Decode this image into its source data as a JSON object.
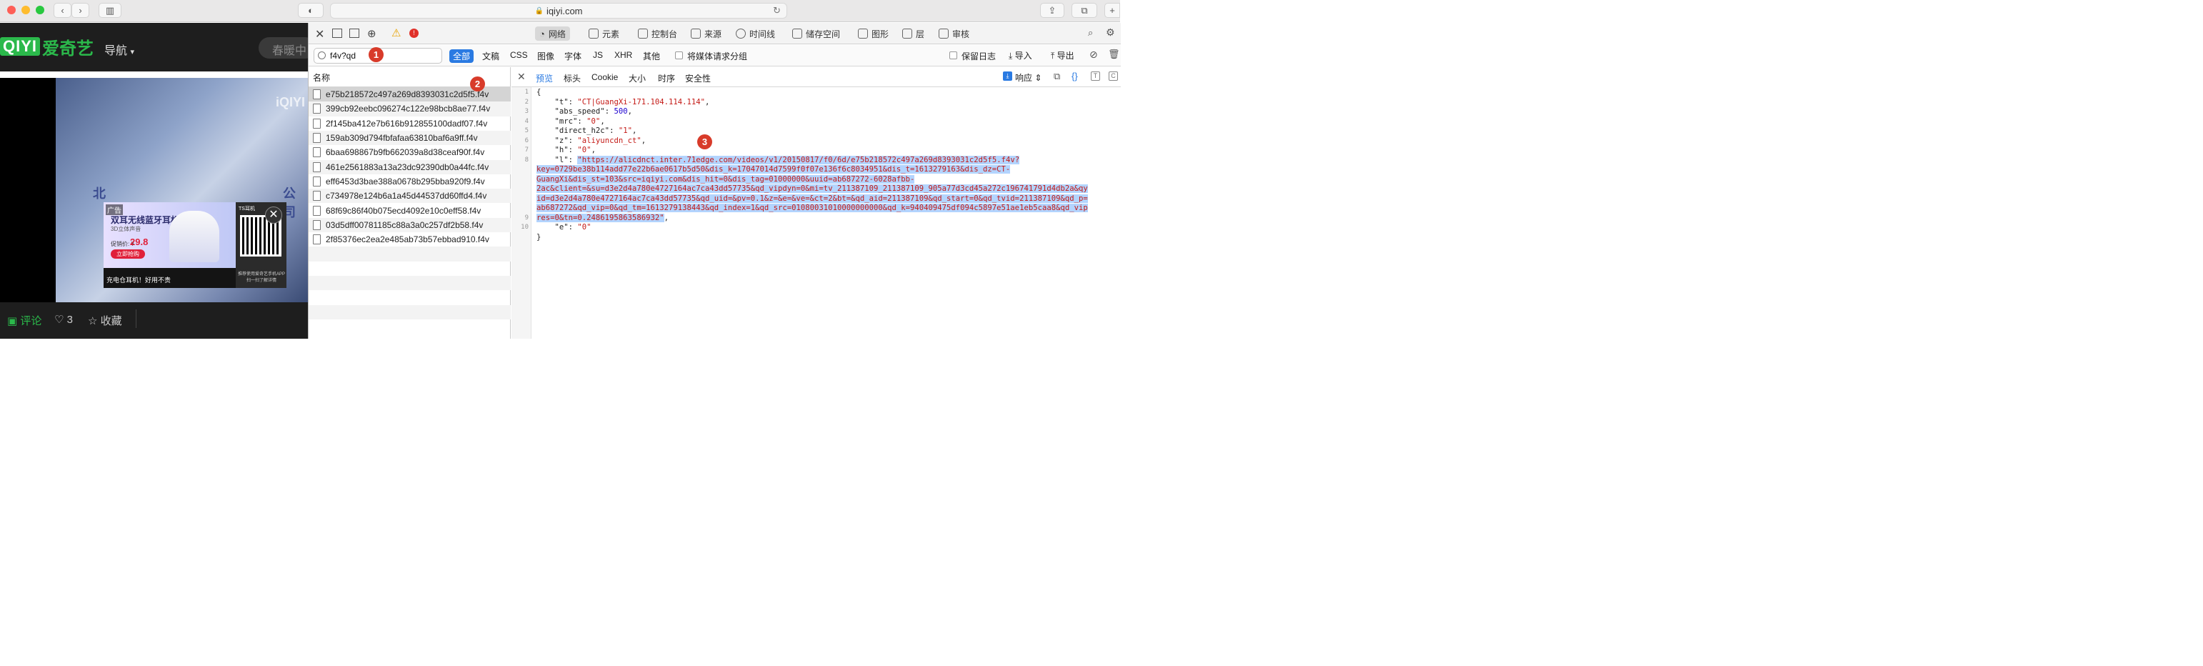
{
  "window": {
    "url": "iqiyi.com"
  },
  "site": {
    "logo_text": "QIYI",
    "logo_name": "爱奇艺",
    "nav": "导航",
    "search_placeholder": "春暖中",
    "ad": {
      "tag": "广告",
      "title": "双耳无线蓝牙耳机",
      "subtitle": "3D立体声音",
      "price_label": "促销价: ¥",
      "price": "29.8",
      "buy": "立即抢购",
      "bottom": "充电仓耳机！好用不贵",
      "right_top": "TS耳机",
      "right_bottom": "推荐使用爱奇艺手机APP\n扫一扫了解详情",
      "close": "✕"
    },
    "video_text_left": "北",
    "video_text_right": "公司",
    "actions": {
      "comment": "评论",
      "likes": "3",
      "fav": "收藏"
    }
  },
  "devtools": {
    "tabs": [
      "网络",
      "元素",
      "控制台",
      "来源",
      "时间线",
      "储存空间",
      "图形",
      "层",
      "审核"
    ],
    "filter": {
      "value": "f4v?qd",
      "types": [
        "全部",
        "文稿",
        "CSS",
        "图像",
        "字体",
        "JS",
        "XHR",
        "其他"
      ],
      "group_media": "将媒体请求分组",
      "preserve_log": "保留日志",
      "import": "导入",
      "export": "导出"
    },
    "list": {
      "header": "名称",
      "items": [
        "e75b218572c497a269d8393031c2d5f5.f4v",
        "399cb92eebc096274c122e98bcb8ae77.f4v",
        "2f145ba412e7b616b912855100dadf07.f4v",
        "159ab309d794fbfafaa63810baf6a9ff.f4v",
        "6baa698867b9fb662039a8d38ceaf90f.f4v",
        "461e2561883a13a23dc92390db0a44fc.f4v",
        "eff6453d3bae388a0678b295bba920f9.f4v",
        "c734978e124b6a1a45d44537dd60ffd4.f4v",
        "68f69c86f40b075ecd4092e10c0eff58.f4v",
        "03d5dff00781185c88a3a0c257df2b58.f4v",
        "2f85376ec2ea2e485ab73b57ebbad910.f4v"
      ]
    },
    "detail": {
      "tabs": [
        "预览",
        "标头",
        "Cookie",
        "大小",
        "时序",
        "安全性"
      ],
      "response": "响应"
    },
    "code": {
      "line_numbers": [
        "1",
        "2",
        "3",
        "4",
        "5",
        "6",
        "7",
        "8",
        "",
        "",
        "",
        "",
        "",
        "9",
        "10"
      ],
      "t_key": "\"t\"",
      "t_val": "\"CT|GuangXi-171.104.114.114\"",
      "abs_key": "\"abs_speed\"",
      "abs_val": "500",
      "mrc_key": "\"mrc\"",
      "mrc_val": "\"0\"",
      "h2c_key": "\"direct_h2c\"",
      "h2c_val": "\"1\"",
      "z_key": "\"z\"",
      "z_val": "\"aliyuncdn_ct\"",
      "h_key": "\"h\"",
      "h_val": "\"0\"",
      "l_key": "\"l\"",
      "l_lines": [
        "\"https://alicdnct.inter.71edge.com/videos/v1/20150817/f0/6d/e75b218572c497a269d8393031c2d5f5.f4v?",
        "key=0729be38b114add77e22b6ae0617b5d50&dis_k=17047014d7599f0f07e136f6c8034951&dis_t=1613279163&dis_dz=CT-",
        "GuangXi&dis_st=103&src=iqiyi.com&dis_hit=0&dis_tag=01000000&uuid=ab687272-6028afbb-",
        "2ac&client=&su=d3e2d4a780e4727164ac7ca43dd57735&qd_vipdyn=0&mi=tv_211387109_211387109_905a77d3cd45a272c196741791d4db2a&qy",
        "id=d3e2d4a780e4727164ac7ca43dd57735&qd_uid=&pv=0.1&z=&e=&ve=&ct=2&bt=&qd_aid=211387109&qd_start=0&qd_tvid=211387109&qd_p=",
        "ab687272&qd_vip=0&qd_tm=1613279138443&qd_index=1&qd_src=01080031010000000000&qd_k=940409475df094c5897e51ae1eb5caa8&qd_vip",
        "res=0&tn=0.2486195863586932\""
      ],
      "e_key": "\"e\"",
      "e_val": "\"0\""
    },
    "badges": [
      "1",
      "2",
      "3"
    ]
  },
  "colors": {
    "accent": "#2a7ae2",
    "badge": "#d83b2a",
    "brand": "#2bb94b"
  }
}
